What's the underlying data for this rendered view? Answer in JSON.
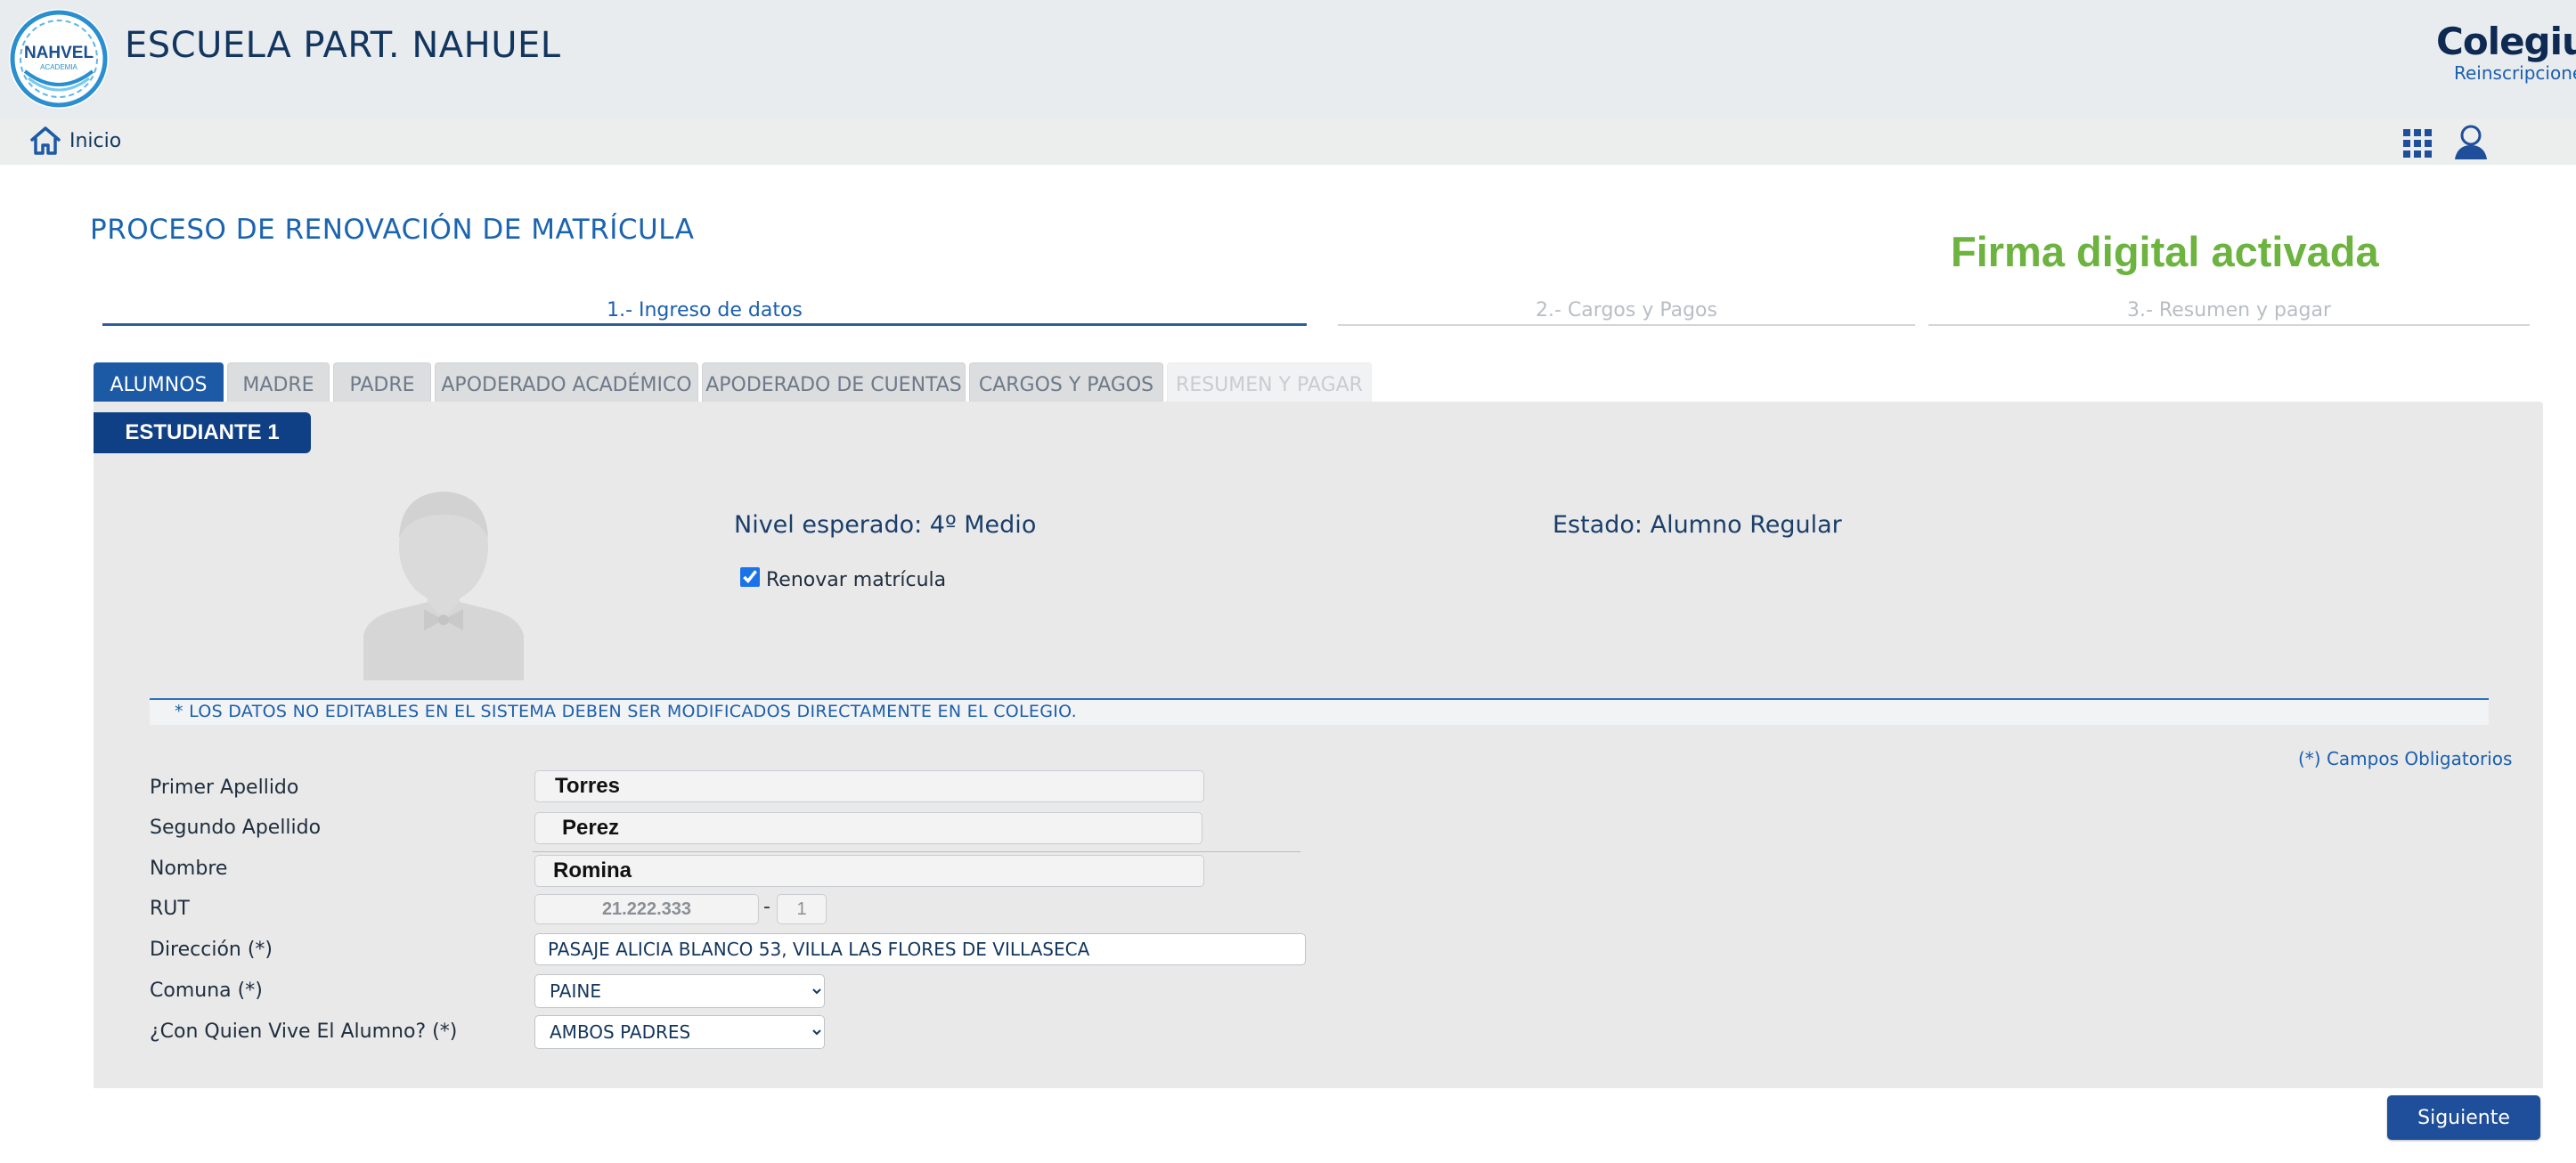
{
  "header": {
    "school_name": "ESCUELA PART. NAHUEL",
    "logo_text": "NAHVEL",
    "brand": "Colegium",
    "brand_sub": "Reinscripciones"
  },
  "nav": {
    "home_label": "Inicio"
  },
  "page": {
    "title": "PROCESO DE RENOVACIÓN DE MATRÍCULA",
    "firma_notice": "Firma digital activada"
  },
  "steps": [
    {
      "label": "1.- Ingreso de datos",
      "state": "active"
    },
    {
      "label": "2.- Cargos y Pagos",
      "state": "pending"
    },
    {
      "label": "3.- Resumen y pagar",
      "state": "pending"
    }
  ],
  "tabs": [
    {
      "label": "ALUMNOS",
      "state": "active"
    },
    {
      "label": "MADRE",
      "state": "normal"
    },
    {
      "label": "PADRE",
      "state": "normal"
    },
    {
      "label": "APODERADO ACADÉMICO",
      "state": "normal"
    },
    {
      "label": "APODERADO DE CUENTAS",
      "state": "normal"
    },
    {
      "label": "CARGOS Y PAGOS",
      "state": "normal"
    },
    {
      "label": "RESUMEN Y PAGAR",
      "state": "disabled"
    }
  ],
  "student": {
    "ribbon": "ESTUDIANTE 1",
    "nivel": "Nivel esperado: 4º Medio",
    "estado": "Estado: Alumno Regular",
    "renovar_label": "Renovar matrícula",
    "renovar_checked": true
  },
  "notice": "* LOS DATOS NO EDITABLES EN EL SISTEMA DEBEN SER MODIFICADOS DIRECTAMENTE EN EL COLEGIO.",
  "required_note": "(*) Campos Obligatorios",
  "form": {
    "primer_apellido": {
      "label": "Primer Apellido",
      "value": "Torres"
    },
    "segundo_apellido": {
      "label": "Segundo Apellido",
      "value": "Perez"
    },
    "nombre": {
      "label": "Nombre",
      "value": "Romina"
    },
    "rut": {
      "label": "RUT",
      "number": "21.222.333",
      "separator": "-",
      "dv": "1"
    },
    "direccion": {
      "label": "Dirección (*)",
      "value": "PASAJE ALICIA BLANCO 53, VILLA LAS FLORES DE VILLASECA"
    },
    "comuna": {
      "label": "Comuna (*)",
      "selected": "PAINE"
    },
    "vive_con": {
      "label": "¿Con Quien Vive El Alumno? (*)",
      "selected": "AMBOS PADRES"
    }
  },
  "actions": {
    "next_label": "Siguiente"
  },
  "colors": {
    "primary": "#1c5aa6",
    "title_blue": "#1b64b0",
    "firma_green": "#6cb33f",
    "panel_bg": "#e9e9e9",
    "header_bg": "#e9ecef"
  }
}
